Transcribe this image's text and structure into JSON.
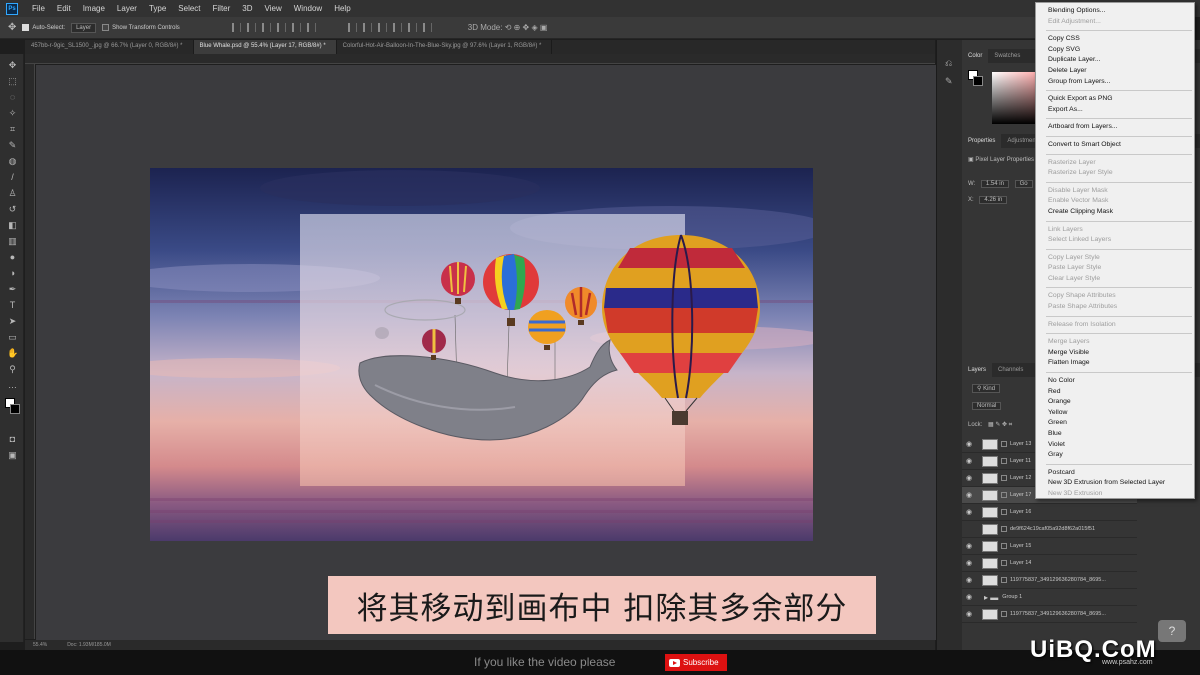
{
  "menubar": {
    "app_icon": "Ps",
    "items": [
      "File",
      "Edit",
      "Image",
      "Layer",
      "Type",
      "Select",
      "Filter",
      "3D",
      "View",
      "Window",
      "Help"
    ]
  },
  "options": {
    "auto_select": "Auto-Select:",
    "target": "Layer",
    "transform_controls": "Show Transform Controls"
  },
  "tabs": [
    "457bb-r-9gic_SL1500_.jpg @ 66.7% (Layer 0, RGB/8#) *",
    "Blue Whale.psd @ 55.4% (Layer 17, RGB/8#) *",
    "Colorful-Hot-Air-Balloon-In-The-Blue-Sky.jpg @ 97.6% (Layer 1, RGB/8#) *"
  ],
  "status": {
    "zoom": "55.4%",
    "doc": "Doc: 1.93M/185.0M"
  },
  "panels": {
    "color_tabs": [
      "Color",
      "Swatches"
    ],
    "properties_tabs": [
      "Properties",
      "Adjustments"
    ],
    "properties_title": "Pixel Layer Properties",
    "w_label": "W:",
    "w_value": "1.54 in",
    "x_label": "X:",
    "x_value": "4.26 in",
    "go_value": "Go",
    "layers_tabs": [
      "Layers",
      "Channels"
    ],
    "kind": "Kind",
    "blend_mode": "Normal",
    "lock_label": "Lock:"
  },
  "layers": [
    {
      "name": "Layer 13",
      "visible": true,
      "selected": false
    },
    {
      "name": "Layer 11",
      "visible": true,
      "selected": false
    },
    {
      "name": "Layer 12",
      "visible": true,
      "selected": false
    },
    {
      "name": "Layer 17",
      "visible": true,
      "selected": true
    },
    {
      "name": "Layer 16",
      "visible": true,
      "selected": false
    },
    {
      "name": "de9f624c19caf05a92d8f62a015f51",
      "visible": false,
      "selected": false
    },
    {
      "name": "Layer 15",
      "visible": true,
      "selected": false
    },
    {
      "name": "Layer 14",
      "visible": true,
      "selected": false
    },
    {
      "name": "119775837_349129636280784_8695...",
      "visible": true,
      "selected": false
    },
    {
      "name": "Group 1",
      "visible": true,
      "selected": false
    },
    {
      "name": "119775837_349129636280784_8695...",
      "visible": true,
      "selected": false
    }
  ],
  "context_menu": [
    {
      "label": "Blending Options...",
      "disabled": false
    },
    {
      "label": "Edit Adjustment...",
      "disabled": true
    },
    {
      "sep": true
    },
    {
      "label": "Copy CSS",
      "disabled": false
    },
    {
      "label": "Copy SVG",
      "disabled": false
    },
    {
      "label": "Duplicate Layer...",
      "disabled": false
    },
    {
      "label": "Delete Layer",
      "disabled": false
    },
    {
      "label": "Group from Layers...",
      "disabled": false
    },
    {
      "sep": true
    },
    {
      "label": "Quick Export as PNG",
      "disabled": false
    },
    {
      "label": "Export As...",
      "disabled": false
    },
    {
      "sep": true
    },
    {
      "label": "Artboard from Layers...",
      "disabled": false
    },
    {
      "sep": true
    },
    {
      "label": "Convert to Smart Object",
      "disabled": false
    },
    {
      "sep": true
    },
    {
      "label": "Rasterize Layer",
      "disabled": true
    },
    {
      "label": "Rasterize Layer Style",
      "disabled": true
    },
    {
      "sep": true
    },
    {
      "label": "Disable Layer Mask",
      "disabled": true
    },
    {
      "label": "Enable Vector Mask",
      "disabled": true
    },
    {
      "label": "Create Clipping Mask",
      "disabled": false
    },
    {
      "sep": true
    },
    {
      "label": "Link Layers",
      "disabled": true
    },
    {
      "label": "Select Linked Layers",
      "disabled": true
    },
    {
      "sep": true
    },
    {
      "label": "Copy Layer Style",
      "disabled": true
    },
    {
      "label": "Paste Layer Style",
      "disabled": true
    },
    {
      "label": "Clear Layer Style",
      "disabled": true
    },
    {
      "sep": true
    },
    {
      "label": "Copy Shape Attributes",
      "disabled": true
    },
    {
      "label": "Paste Shape Attributes",
      "disabled": true
    },
    {
      "sep": true
    },
    {
      "label": "Release from Isolation",
      "disabled": true
    },
    {
      "sep": true
    },
    {
      "label": "Merge Layers",
      "disabled": true
    },
    {
      "label": "Merge Visible",
      "disabled": false
    },
    {
      "label": "Flatten Image",
      "disabled": false
    },
    {
      "sep": true
    },
    {
      "label": "No Color",
      "disabled": false
    },
    {
      "label": "Red",
      "disabled": false
    },
    {
      "label": "Orange",
      "disabled": false
    },
    {
      "label": "Yellow",
      "disabled": false
    },
    {
      "label": "Green",
      "disabled": false
    },
    {
      "label": "Blue",
      "disabled": false
    },
    {
      "label": "Violet",
      "disabled": false
    },
    {
      "label": "Gray",
      "disabled": false
    },
    {
      "sep": true
    },
    {
      "label": "Postcard",
      "disabled": false
    },
    {
      "label": "New 3D Extrusion from Selected Layer",
      "disabled": false
    },
    {
      "label": "New 3D Extrusion",
      "disabled": true
    }
  ],
  "overlay": {
    "subtitle": "将其移动到画布中 扣除其多余部分",
    "bottom_text": "If you like the video please",
    "subscribe": "Subscribe",
    "watermark": "UiBQ.CoM",
    "watermark_sub": "www.psahz.com"
  },
  "colors": {
    "accent": "#31a8ff",
    "subtitle_bg": "#f3c7bf",
    "subscribe_bg": "#dd1111"
  }
}
